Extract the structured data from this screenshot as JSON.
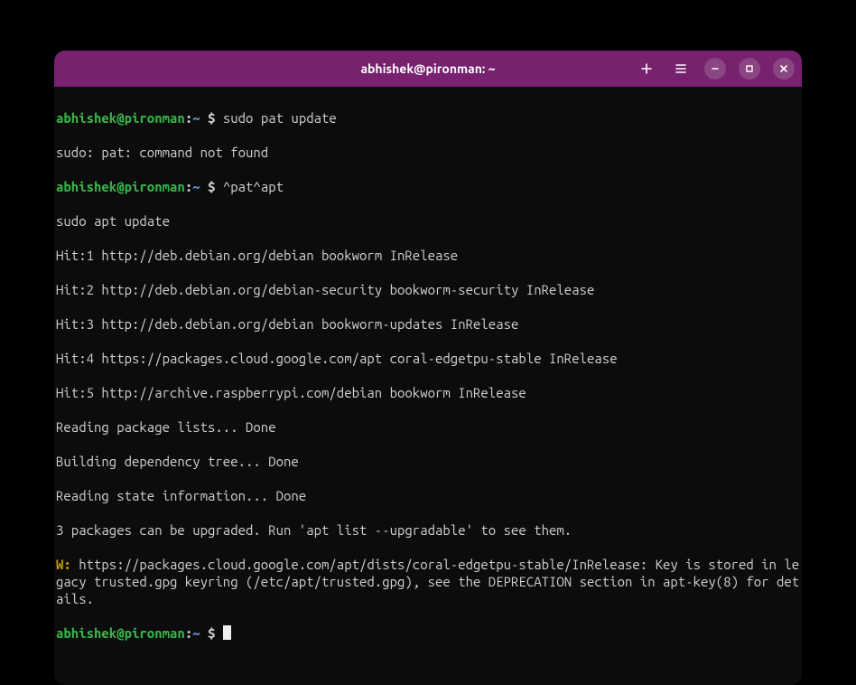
{
  "titlebar": {
    "title": "abhishek@pironman: ~",
    "icons": {
      "new_tab": "new-tab-icon",
      "menu": "menu-icon",
      "minimize": "minimize-icon",
      "maximize": "maximize-icon",
      "close": "close-icon"
    }
  },
  "prompt": {
    "user": "abhishek",
    "at": "@",
    "host": "pironman",
    "colon": ":",
    "path": "~",
    "dollar": " $ "
  },
  "session": {
    "cmd1": "sudo pat update",
    "err1": "sudo: pat: command not found",
    "cmd2": "^pat^apt",
    "expanded": "sudo apt update",
    "out": [
      "Hit:1 http://deb.debian.org/debian bookworm InRelease",
      "Hit:2 http://deb.debian.org/debian-security bookworm-security InRelease",
      "Hit:3 http://deb.debian.org/debian bookworm-updates InRelease",
      "Hit:4 https://packages.cloud.google.com/apt coral-edgetpu-stable InRelease",
      "Hit:5 http://archive.raspberrypi.com/debian bookworm InRelease",
      "Reading package lists... Done",
      "Building dependency tree... Done",
      "Reading state information... Done",
      "3 packages can be upgraded. Run 'apt list --upgradable' to see them."
    ],
    "warn_prefix": "W: ",
    "warn_text": "https://packages.cloud.google.com/apt/dists/coral-edgetpu-stable/InRelease: Key is stored in legacy trusted.gpg keyring (/etc/apt/trusted.gpg), see the DEPRECATION section in apt-key(8) for details."
  }
}
